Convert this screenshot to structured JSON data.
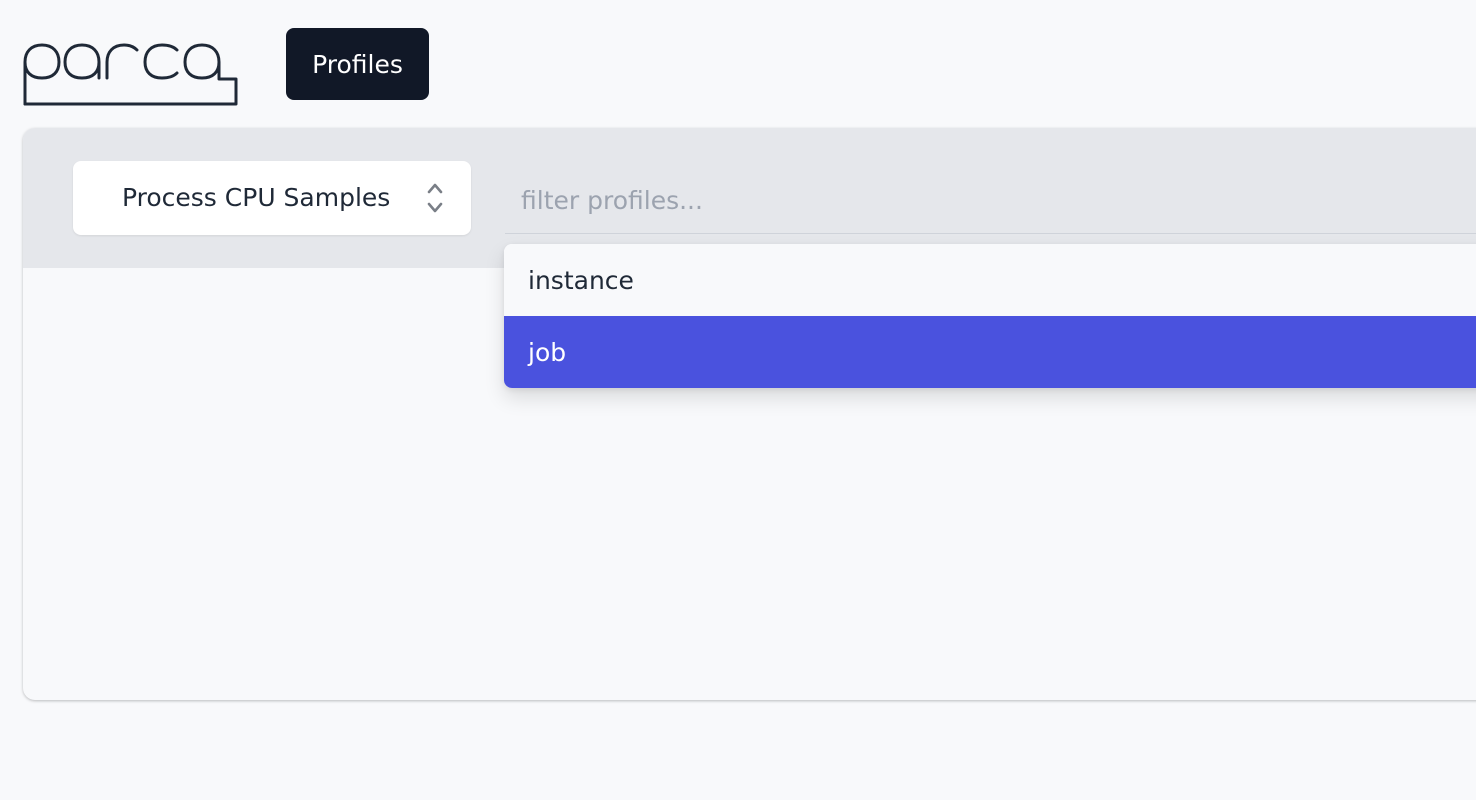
{
  "brand": {
    "logo_text": "parca",
    "color": "#1f2937"
  },
  "nav": {
    "profiles_label": "Profiles"
  },
  "profile_select": {
    "value": "Process CPU Samples",
    "icon": "chevron-up-down-icon"
  },
  "filter": {
    "placeholder": "filter profiles..."
  },
  "dropdown": {
    "options": [
      {
        "label": "instance",
        "highlighted": false
      },
      {
        "label": "job",
        "highlighted": true
      }
    ],
    "highlight_color": "#4a52de"
  },
  "colors": {
    "nav_background": "#111827",
    "panel_header": "#e5e7eb",
    "page_background": "#f8f9fb"
  }
}
